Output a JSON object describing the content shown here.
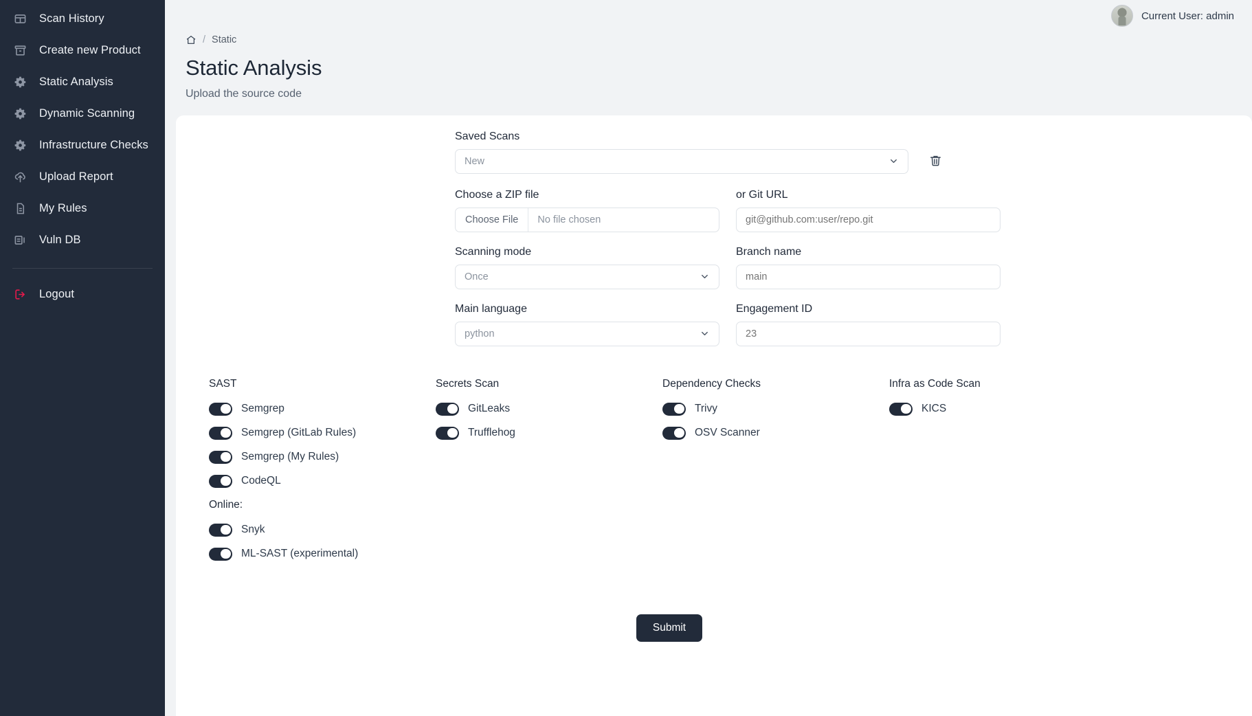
{
  "sidebar": {
    "items": [
      {
        "label": "Scan History",
        "icon": "table-icon"
      },
      {
        "label": "Create new Product",
        "icon": "archive-box-icon"
      },
      {
        "label": "Static Analysis",
        "icon": "gear-icon"
      },
      {
        "label": "Dynamic Scanning",
        "icon": "gear-icon"
      },
      {
        "label": "Infrastructure Checks",
        "icon": "gear-icon"
      },
      {
        "label": "Upload Report",
        "icon": "cloud-upload-icon"
      },
      {
        "label": "My Rules",
        "icon": "document-icon"
      },
      {
        "label": "Vuln DB",
        "icon": "database-icon"
      }
    ],
    "logout": {
      "label": "Logout",
      "icon": "logout-icon"
    }
  },
  "topbar": {
    "user_text": "Current User: admin",
    "avatar_icon": "avatar"
  },
  "header": {
    "breadcrumb_home_icon": "home-icon",
    "breadcrumb_separator": "/",
    "breadcrumb_current": "Static",
    "title": "Static Analysis",
    "subtitle": "Upload the source code"
  },
  "form": {
    "saved_scans": {
      "label": "Saved Scans",
      "value": "New",
      "chevron_icon": "chevron-down-icon",
      "delete_icon": "trash-icon"
    },
    "zip_file": {
      "label": "Choose a ZIP file",
      "button_label": "Choose File",
      "status": "No file chosen"
    },
    "git_url": {
      "label": "or Git URL",
      "placeholder": "git@github.com:user/repo.git",
      "value": ""
    },
    "scanning_mode": {
      "label": "Scanning mode",
      "value": "Once",
      "chevron_icon": "chevron-down-icon"
    },
    "branch_name": {
      "label": "Branch name",
      "placeholder": "main",
      "value": ""
    },
    "main_language": {
      "label": "Main language",
      "value": "python",
      "chevron_icon": "chevron-down-icon"
    },
    "engagement_id": {
      "label": "Engagement ID",
      "placeholder": "23",
      "value": ""
    },
    "submit_label": "Submit"
  },
  "scanners": {
    "sast": {
      "heading": "SAST",
      "items": [
        {
          "label": "Semgrep",
          "on": true
        },
        {
          "label": "Semgrep (GitLab Rules)",
          "on": true
        },
        {
          "label": "Semgrep (My Rules)",
          "on": true
        },
        {
          "label": "CodeQL",
          "on": true
        }
      ],
      "online_heading": "Online:",
      "online_items": [
        {
          "label": "Snyk",
          "on": true
        },
        {
          "label": "ML-SAST (experimental)",
          "on": true
        }
      ]
    },
    "secrets": {
      "heading": "Secrets Scan",
      "items": [
        {
          "label": "GitLeaks",
          "on": true
        },
        {
          "label": "Trufflehog",
          "on": true
        }
      ]
    },
    "dependency": {
      "heading": "Dependency Checks",
      "items": [
        {
          "label": "Trivy",
          "on": true
        },
        {
          "label": "OSV Scanner",
          "on": true
        }
      ]
    },
    "infra": {
      "heading": "Infra as Code Scan",
      "items": [
        {
          "label": "KICS",
          "on": true
        }
      ]
    }
  },
  "colors": {
    "sidebar_bg": "#222b3a",
    "page_bg": "#f1f3f5",
    "card_bg": "#ffffff",
    "accent": "#222b3a",
    "logout": "#e8194b"
  }
}
